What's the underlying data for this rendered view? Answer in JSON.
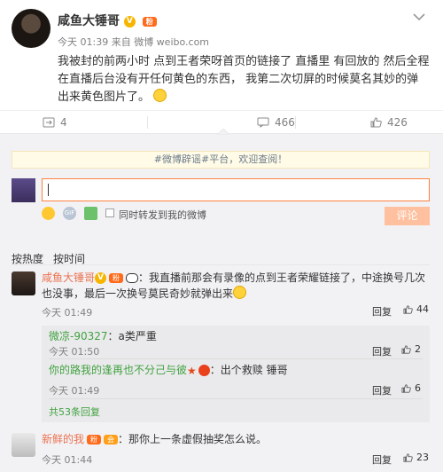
{
  "post": {
    "author": "咸鱼大锤哥",
    "meta": "今天 01:39 来自 微博 weibo.com",
    "text": "我被封的前两小时 点到王者荣呀首页的链接了  直播里 有回放的  然后全程在直播后台没有开任何黄色的东西，  我第二次切屏的时候莫名其妙的弹出来黄色图片了。",
    "repost_count": "4",
    "comment_count": "466",
    "like_count": "426"
  },
  "comments_panel": {
    "notice": "#微博辟谣#平台，欢迎查阅！",
    "input_value": "",
    "also_repost_label": "同时转发到我的微博",
    "submit_label": "评论",
    "tabs": [
      "按热度",
      "按时间"
    ]
  },
  "comments": [
    {
      "name": "咸鱼大锤哥",
      "text": "：我直播前那会有录像的点到王者荣耀链接了，中途换号几次也没事，最后一次换号莫民奇妙就弹出来",
      "time": "今天 01:49",
      "reply_label": "回复",
      "likes": "44"
    },
    {
      "name": "新鲜的我",
      "text": "：那你上一条虚假抽奖怎么说。",
      "time": "今天 01:44",
      "reply_label": "回复",
      "likes": "23"
    }
  ],
  "sub_comments": [
    {
      "name": "微凉-90327",
      "text": "：a类严重",
      "time": "今天 01:50",
      "reply_label": "回复",
      "likes": "2"
    },
    {
      "name": "你的路我的逢再也不分己与彼",
      "text": "：出个救赎 锤哥",
      "time": "今天 01:49",
      "reply_label": "回复",
      "likes": "6"
    }
  ],
  "more_replies": "共53条回复",
  "colors": {
    "accent": "#eb7350",
    "sub_name": "#41a240",
    "button_disabled": "#ffc09f"
  }
}
